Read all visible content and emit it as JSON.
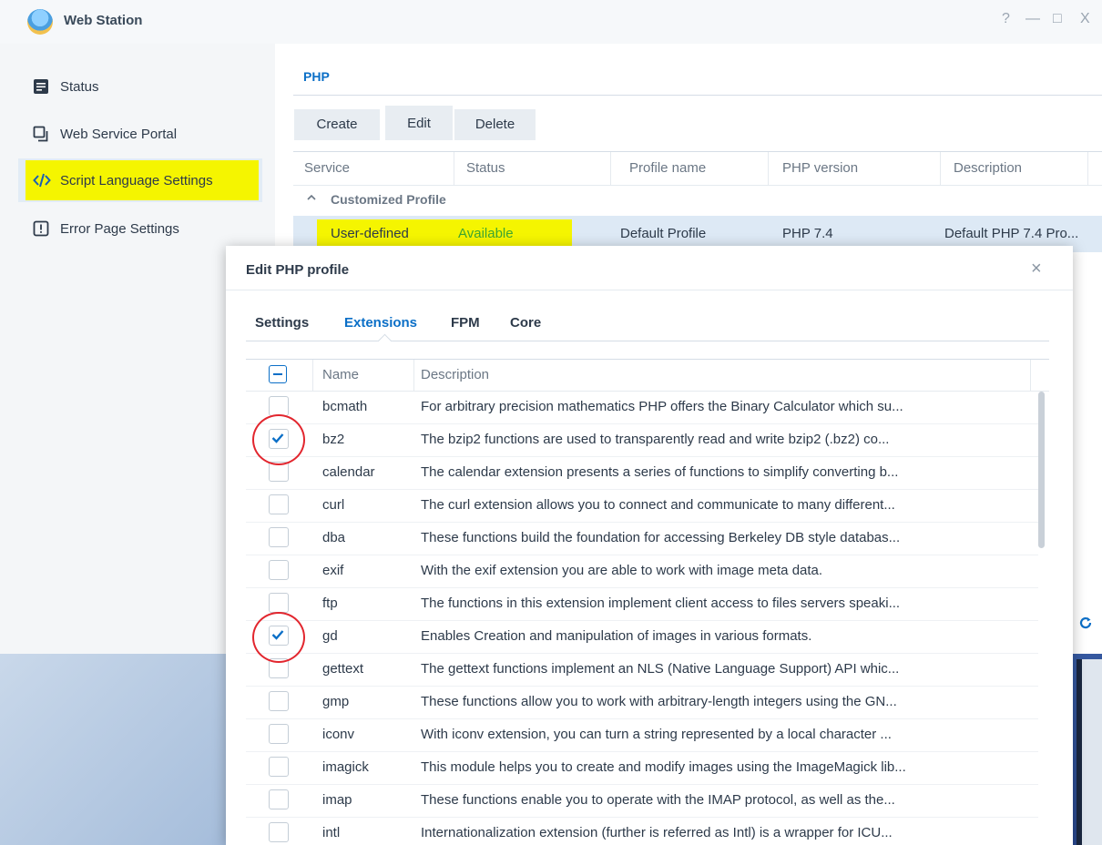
{
  "window": {
    "title": "Web Station",
    "controls": [
      "?",
      "—",
      "□",
      "X"
    ]
  },
  "sidebar": {
    "items": [
      {
        "label": "Status",
        "icon": "status-icon"
      },
      {
        "label": "Web Service Portal",
        "icon": "portal-icon"
      },
      {
        "label": "Script Language Settings",
        "icon": "code-icon"
      },
      {
        "label": "Error Page Settings",
        "icon": "error-page-icon"
      }
    ]
  },
  "main": {
    "tab": "PHP",
    "toolbar": {
      "create": "Create",
      "edit": "Edit",
      "delete": "Delete"
    },
    "columns": [
      "Service",
      "Status",
      "Profile name",
      "PHP version",
      "Description"
    ],
    "group": "Customized Profile",
    "row": {
      "service": "User-defined",
      "status": "Available",
      "profile": "Default Profile",
      "version": "PHP 7.4",
      "description": "Default PHP 7.4 Pro..."
    },
    "refresh_icon": "refresh-icon"
  },
  "dialog": {
    "title": "Edit PHP profile",
    "close": "×",
    "tabs": [
      "Settings",
      "Extensions",
      "FPM",
      "Core"
    ],
    "active_tab": "Extensions",
    "columns": [
      "Name",
      "Description"
    ],
    "extensions": [
      {
        "name": "bcmath",
        "checked": false,
        "description": "For arbitrary precision mathematics PHP offers the Binary Calculator which su..."
      },
      {
        "name": "bz2",
        "checked": true,
        "description": "The bzip2 functions are used to transparently read and write bzip2 (.bz2) co..."
      },
      {
        "name": "calendar",
        "checked": false,
        "description": "The calendar extension presents a series of functions to simplify converting b..."
      },
      {
        "name": "curl",
        "checked": false,
        "description": "The curl extension allows you to connect and communicate to many different..."
      },
      {
        "name": "dba",
        "checked": false,
        "description": "These functions build the foundation for accessing Berkeley DB style databas..."
      },
      {
        "name": "exif",
        "checked": false,
        "description": "With the exif extension you are able to work with image meta data."
      },
      {
        "name": "ftp",
        "checked": false,
        "description": "The functions in this extension implement client access to files servers speaki..."
      },
      {
        "name": "gd",
        "checked": true,
        "description": "Enables Creation and manipulation of images in various formats."
      },
      {
        "name": "gettext",
        "checked": false,
        "description": "The gettext functions implement an NLS (Native Language Support) API whic..."
      },
      {
        "name": "gmp",
        "checked": false,
        "description": "These functions allow you to work with arbitrary-length integers using the GN..."
      },
      {
        "name": "iconv",
        "checked": false,
        "description": "With iconv extension, you can turn a string represented by a local character ..."
      },
      {
        "name": "imagick",
        "checked": false,
        "description": "This module helps you to create and modify images using the ImageMagick lib..."
      },
      {
        "name": "imap",
        "checked": false,
        "description": "These functions enable you to operate with the IMAP protocol, as well as the..."
      },
      {
        "name": "intl",
        "checked": false,
        "description": "Internationalization extension (further is referred as Intl) is a wrapper for ICU..."
      }
    ]
  },
  "colors": {
    "accent": "#0b6fc7",
    "highlight": "#f5f500",
    "available": "#3ea632",
    "annotation": "#e2262e"
  }
}
